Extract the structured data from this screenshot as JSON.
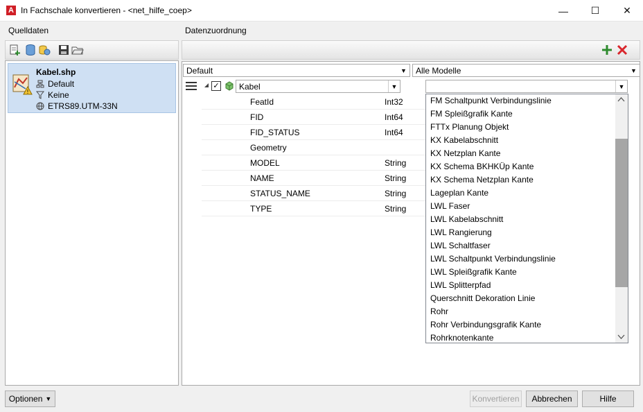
{
  "window": {
    "title": "In Fachschale konvertieren - <net_hilfe_coep>",
    "app_icon": "A",
    "minimize": "—",
    "maximize": "☐",
    "close": "✕"
  },
  "left": {
    "section_label": "Quelldaten",
    "source": {
      "name": "Kabel.shp",
      "model": "Default",
      "filter": "Keine",
      "crs": "ETRS89.UTM-33N"
    }
  },
  "right": {
    "section_label": "Datenzuordnung",
    "profile_combo": "Default",
    "model_combo": "Alle Modelle",
    "layer_combo": "Kabel",
    "target_combo": "",
    "fields": [
      {
        "name": "FeatId",
        "type": "Int32"
      },
      {
        "name": "FID",
        "type": "Int64"
      },
      {
        "name": "FID_STATUS",
        "type": "Int64"
      },
      {
        "name": "Geometry",
        "type": ""
      },
      {
        "name": "MODEL",
        "type": "String"
      },
      {
        "name": "NAME",
        "type": "String"
      },
      {
        "name": "STATUS_NAME",
        "type": "String"
      },
      {
        "name": "TYPE",
        "type": "String"
      }
    ],
    "dropdown_items": [
      "FM Schaltpunkt Verbindungslinie",
      "FM Spleißgrafik Kante",
      "FTTx Planung Objekt",
      "KX Kabelabschnitt",
      "KX Netzplan Kante",
      "KX Schema BKHKÜp Kante",
      "KX Schema Netzplan Kante",
      "Lageplan Kante",
      "LWL Faser",
      "LWL Kabelabschnitt",
      "LWL Rangierung",
      "LWL Schaltfaser",
      "LWL Schaltpunkt Verbindungslinie",
      "LWL Spleißgrafik Kante",
      "LWL Splitterpfad",
      "Querschnitt Dekoration Linie",
      "Rohr",
      "Rohr Verbindungsgrafik Kante",
      "Rohrknotenkante"
    ]
  },
  "buttons": {
    "options": "Optionen",
    "convert": "Konvertieren",
    "cancel": "Abbrechen",
    "help": "Hilfe"
  },
  "colors": {
    "selection": "#cfe0f3",
    "app_red": "#d01f27",
    "add_green": "#2e8b2e",
    "delete_red": "#d9262c"
  }
}
